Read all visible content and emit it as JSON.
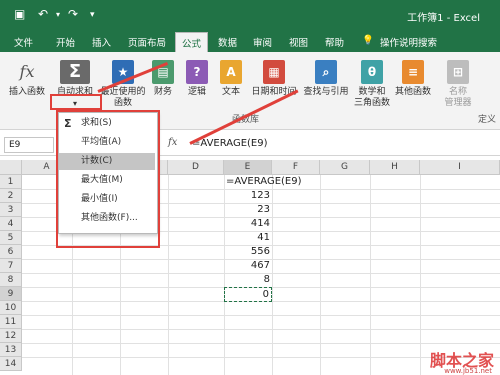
{
  "titlebar": {
    "title": "工作簿1 - Excel",
    "save_icon": "save-icon",
    "undo_icon": "undo-icon"
  },
  "tabs": [
    "文件",
    "开始",
    "插入",
    "页面布局",
    "公式",
    "数据",
    "审阅",
    "视图",
    "帮助"
  ],
  "active_tab": "公式",
  "tell_me": "操作说明搜索",
  "ribbon": {
    "insert_function": "插入函数",
    "autosum": "自动求和",
    "recent": [
      "最近使用的",
      "函数"
    ],
    "finance": "财务",
    "logic": "逻辑",
    "text": "文本",
    "datetime": "日期和时间",
    "lookup": "查找与引用",
    "math": [
      "数学和",
      "三角函数"
    ],
    "other": "其他函数",
    "names": [
      "名称",
      "管理器"
    ],
    "group_label": "函数库",
    "define_label": "定义"
  },
  "formula_bar": {
    "name_box": "E9",
    "fx": "fx",
    "formula": "=AVERAGE(E9)"
  },
  "columns": [
    "A",
    "B",
    "C",
    "D",
    "E",
    "F",
    "G",
    "H",
    "I"
  ],
  "rows": [
    "1",
    "2",
    "3",
    "4",
    "5",
    "6",
    "7",
    "8",
    "9",
    "10",
    "11",
    "12",
    "13",
    "14"
  ],
  "cells": {
    "e1": "=AVERAGE(E9)",
    "e2": "123",
    "e3": "23",
    "e4": "414",
    "e5": "41",
    "e6": "556",
    "e7": "467",
    "e8": "8",
    "e9": "0"
  },
  "dropdown": [
    "求和(S)",
    "平均值(A)",
    "计数(C)",
    "最大值(M)",
    "最小值(I)",
    "其他函数(F)..."
  ],
  "dropdown_selected": "计数(C)",
  "colors": {
    "excel_green": "#217346",
    "highlight_red": "#e0403a"
  },
  "watermark": {
    "main": "脚本之家",
    "sub": "www.jb51.net"
  }
}
